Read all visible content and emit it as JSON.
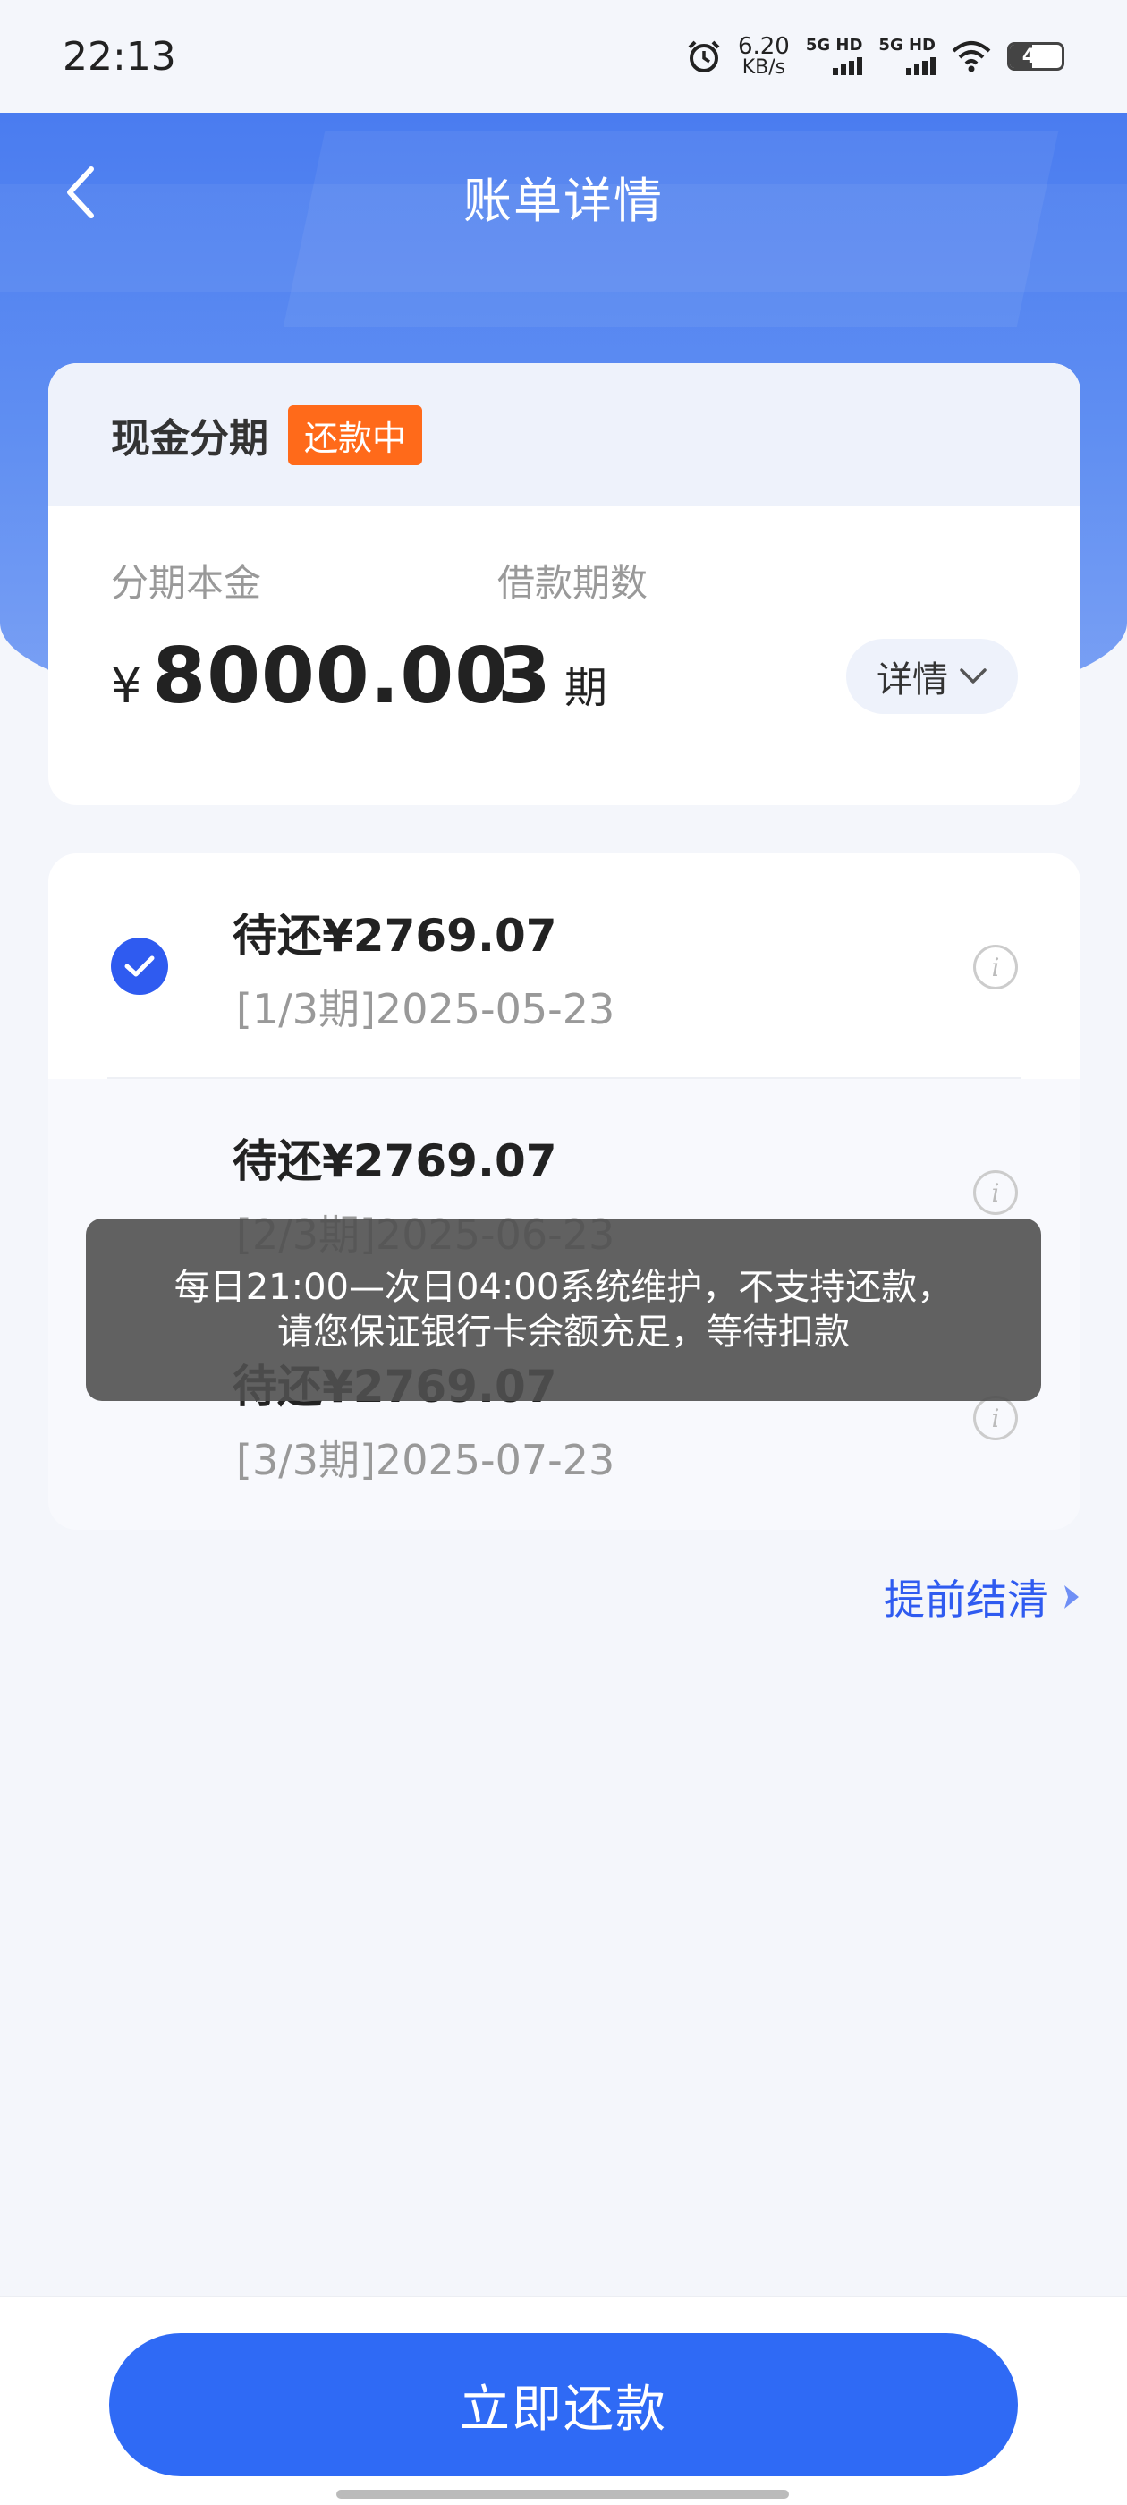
{
  "status_bar": {
    "time": "22:13",
    "net_speed_value": "6.20",
    "net_speed_unit": "KB/s",
    "sim1_label": "5G HD",
    "sim2_label": "5G HD",
    "battery_level": "43",
    "icons": [
      "alarm-icon",
      "signal-icon",
      "wifi-icon",
      "battery-icon"
    ]
  },
  "header": {
    "title": "账单详情",
    "back_icon": "chevron-left-icon"
  },
  "summary": {
    "type": "现金分期",
    "status_badge": "还款中",
    "principal_label": "分期本金",
    "currency": "¥",
    "principal_value": "8000.00",
    "periods_label": "借款期数",
    "periods_value": "3",
    "periods_unit": "期",
    "detail_button": "详情"
  },
  "installments": [
    {
      "amount": "待还¥2769.07",
      "period": "[1/3期]2025-05-23",
      "selected": true
    },
    {
      "amount": "待还¥2769.07",
      "period": "[2/3期]2025-06-23",
      "selected": false
    },
    {
      "amount": "待还¥2769.07",
      "period": "[3/3期]2025-07-23",
      "selected": false
    }
  ],
  "toast": {
    "line1": "每日21:00—次日04:00系统维护，不支持还款，",
    "line2": "请您保证银行卡余额充足，等待扣款"
  },
  "settle_link": "提前结清",
  "pay_button": "立即还款",
  "colors": {
    "primary": "#2f6af5",
    "badge": "#ff6a1a",
    "banner": "#4a7cf0"
  }
}
